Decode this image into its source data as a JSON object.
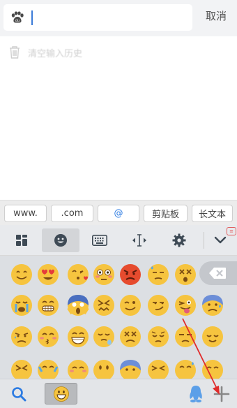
{
  "search": {
    "placeholder": "",
    "cancel_label": "取消"
  },
  "history": {
    "clear_label": "清空输入历史"
  },
  "quickbar": {
    "items": [
      "www.",
      ".com",
      "@",
      "剪贴板",
      "长文本"
    ]
  },
  "toolbar": {
    "icons": [
      "grid-icon",
      "emoji-icon",
      "keyboard-icon",
      "cursor-move-icon",
      "gear-icon",
      "chevron-down-icon"
    ],
    "active": "emoji-icon"
  },
  "emoji_rows": [
    [
      "smile",
      "heart-eyes",
      "kiss-heart",
      "flushed",
      "angry",
      "sweat",
      "dizzy"
    ],
    [
      "crying",
      "grimace",
      "scream",
      "confounded",
      "wink",
      "smirk",
      "tongue-wink",
      "cold-sweat"
    ],
    [
      "disappointed",
      "kissing-smile",
      "grin",
      "sleepy",
      "dizzy",
      "pensive",
      "unamused",
      "relieved"
    ],
    [
      "persevere",
      "joy",
      "blush",
      "neutral",
      "fearful",
      "laughing",
      "sweat-smile",
      "sad"
    ]
  ],
  "bottombar": {
    "icons": [
      "search-icon",
      "emoji-icon",
      "penguin-icon",
      "plus-icon"
    ]
  },
  "colors": {
    "accent": "#2a7ae2",
    "annotation_arrow": "#e02b2b",
    "emoji_fill": "#f6c43f"
  }
}
